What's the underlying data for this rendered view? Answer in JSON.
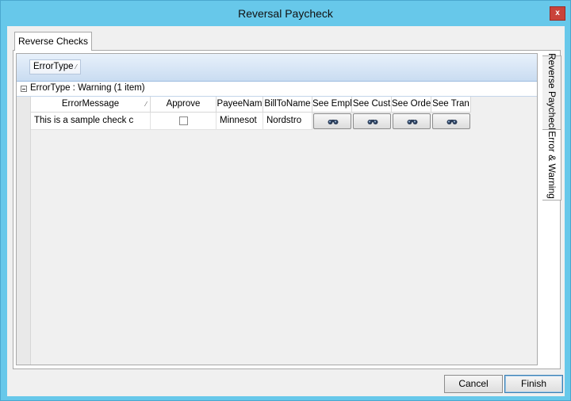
{
  "window": {
    "title": "Reversal Paycheck",
    "close_label": "x"
  },
  "outer_tab": {
    "label": "Reverse Checks"
  },
  "side_tabs": [
    {
      "label": "Reverse Paycheck"
    },
    {
      "label": "Error & Warning"
    }
  ],
  "grid": {
    "group_by_chip": "ErrorType",
    "group_row": "ErrorType : Warning (1 item)",
    "columns": [
      "ErrorMessage",
      "Approve",
      "PayeeNam",
      "BillToName",
      "See Empl",
      "See Cust",
      "See Orde",
      "See Tran"
    ],
    "row": {
      "error_message": "This is a sample check c",
      "payee_name": "Minnesot",
      "bill_to_name": "Nordstro"
    }
  },
  "buttons": {
    "cancel": "Cancel",
    "finish": "Finish"
  }
}
